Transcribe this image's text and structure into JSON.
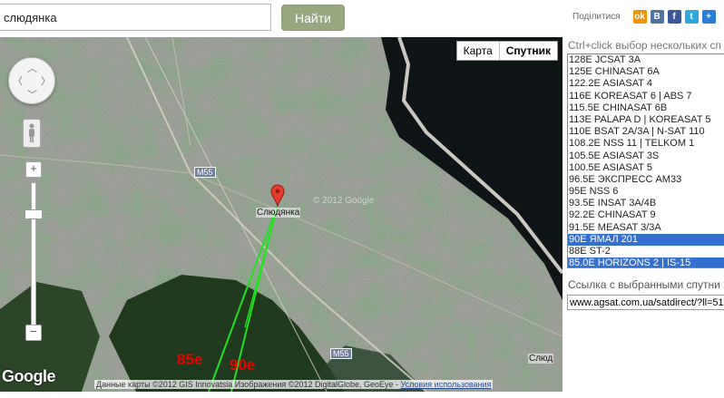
{
  "search": {
    "value": "слюдянка",
    "button": "Найти"
  },
  "share": {
    "label": "Поділитися",
    "icons": [
      {
        "name": "odnoklassniki-icon",
        "glyph": "ok",
        "color": "#f39200"
      },
      {
        "name": "vkontakte-icon",
        "glyph": "В",
        "color": "#4c75a3"
      },
      {
        "name": "facebook-icon",
        "glyph": "f",
        "color": "#3b5998"
      },
      {
        "name": "twitter-icon",
        "glyph": "t",
        "color": "#2aa9e0"
      },
      {
        "name": "more-share-icon",
        "glyph": "+",
        "color": "#2d7fd2"
      }
    ]
  },
  "map": {
    "type_buttons": [
      "Карта",
      "Спутник"
    ],
    "active_type": "Спутник",
    "city_label": "Слюдянка",
    "road_label": "M55",
    "corner_label": "Слюд",
    "watermark": "© 2012 Google",
    "line_labels": {
      "a": "85e",
      "b": "90e"
    },
    "google_logo": "Google",
    "attribution": "Данные карты ©2012 GIS Innovatsia Изображения ©2012 DigitalGlobe, GeoEye -",
    "attribution_link": "Условия использования",
    "colors": {
      "line": "#22e022",
      "label": "#e00000"
    }
  },
  "panel": {
    "hint": "Ctrl+click выбор нескольких сп",
    "satellites": [
      {
        "label": "128E JCSAT 3A",
        "selected": false
      },
      {
        "label": "125E CHINASAT 6A",
        "selected": false
      },
      {
        "label": "122.2E ASIASAT 4",
        "selected": false
      },
      {
        "label": "116E KOREASAT 6 | ABS 7",
        "selected": false
      },
      {
        "label": "115.5E CHINASAT 6B",
        "selected": false
      },
      {
        "label": "113E PALAPA D | KOREASAT 5",
        "selected": false
      },
      {
        "label": "110E BSAT 2A/3A | N-SAT 110",
        "selected": false
      },
      {
        "label": "108.2E NSS 11 | TELKOM 1",
        "selected": false
      },
      {
        "label": "105.5E ASIASAT 3S",
        "selected": false
      },
      {
        "label": "100.5E ASIASAT 5",
        "selected": false
      },
      {
        "label": "96.5E ЭКСПРЕСС АМ33",
        "selected": false
      },
      {
        "label": "95E NSS 6",
        "selected": false
      },
      {
        "label": "93.5E INSAT 3A/4B",
        "selected": false
      },
      {
        "label": "92.2E CHINASAT 9",
        "selected": false
      },
      {
        "label": "91.5E MEASAT 3/3A",
        "selected": false
      },
      {
        "label": "90E ЯМАЛ 201",
        "selected": true
      },
      {
        "label": "88E ST-2",
        "selected": false
      },
      {
        "label": "85.0E HORIZONS 2 | IS-15",
        "selected": true
      }
    ],
    "link_label": "Ссылка с выбранными спутни",
    "link_value": "www.agsat.com.ua/satdirect/?ll=51."
  }
}
